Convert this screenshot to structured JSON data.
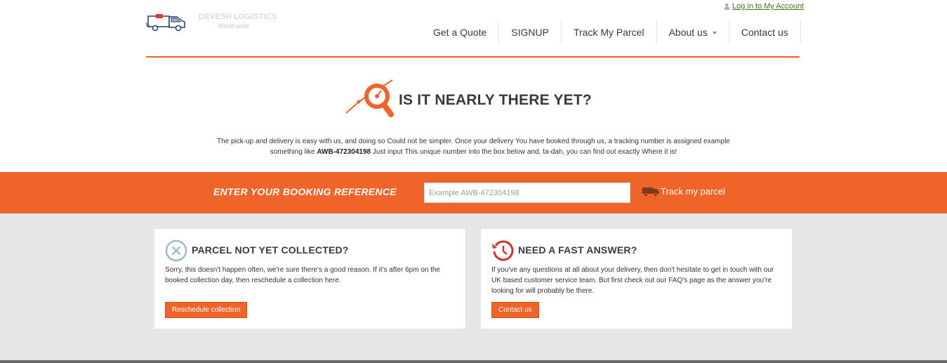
{
  "header": {
    "brand_name": "DEVESH LOGISTICS",
    "brand_tagline": "World-wide",
    "login_link": "Log in to My Account",
    "nav": [
      {
        "label": "Get a Quote"
      },
      {
        "label": "SIGNUP"
      },
      {
        "label": "Track My Parcel"
      },
      {
        "label": "About us",
        "has_dropdown": true
      },
      {
        "label": "Contact us"
      }
    ]
  },
  "hero": {
    "title": "IS IT NEARLY THERE YET?",
    "text_part1": "The pick-up and delivery is easy with us, and doing so Could not be simpler. Once your delivery You have booked through us, a tracking number is assigned example something like ",
    "text_bold": "AWB-472304198",
    "text_part2": " Just input This unique number into the box below and, ta-dah, you can find out exactly Where it is!"
  },
  "booking": {
    "label": "ENTER YOUR BOOKING REFERENCE",
    "input_placeholder": "Example AWB-472304198",
    "input_value": "",
    "track_button": "Track my parcel"
  },
  "cards": [
    {
      "title": "PARCEL NOT YET COLLECTED?",
      "text": "Sorry, this doesn't happen often, we're sure there's a good reason. If it's after 6pm on the booked collection day, then reschedule a collection here.",
      "button": "Reschedule collection",
      "icon": "close-circle-icon"
    },
    {
      "title": "NEED A FAST ANSWER?",
      "text": "If you've any questions at all about your delivery, then don't hesitate to get in touch with our UK based customer service team. But first check out our FAQ's page as the answer you're looking for will probably be there.",
      "button": "Contact us",
      "icon": "history-clock-icon"
    }
  ],
  "colors": {
    "accent": "#ef6428",
    "link_green": "#3c7a1e",
    "grey_background": "#e6e6e6"
  }
}
